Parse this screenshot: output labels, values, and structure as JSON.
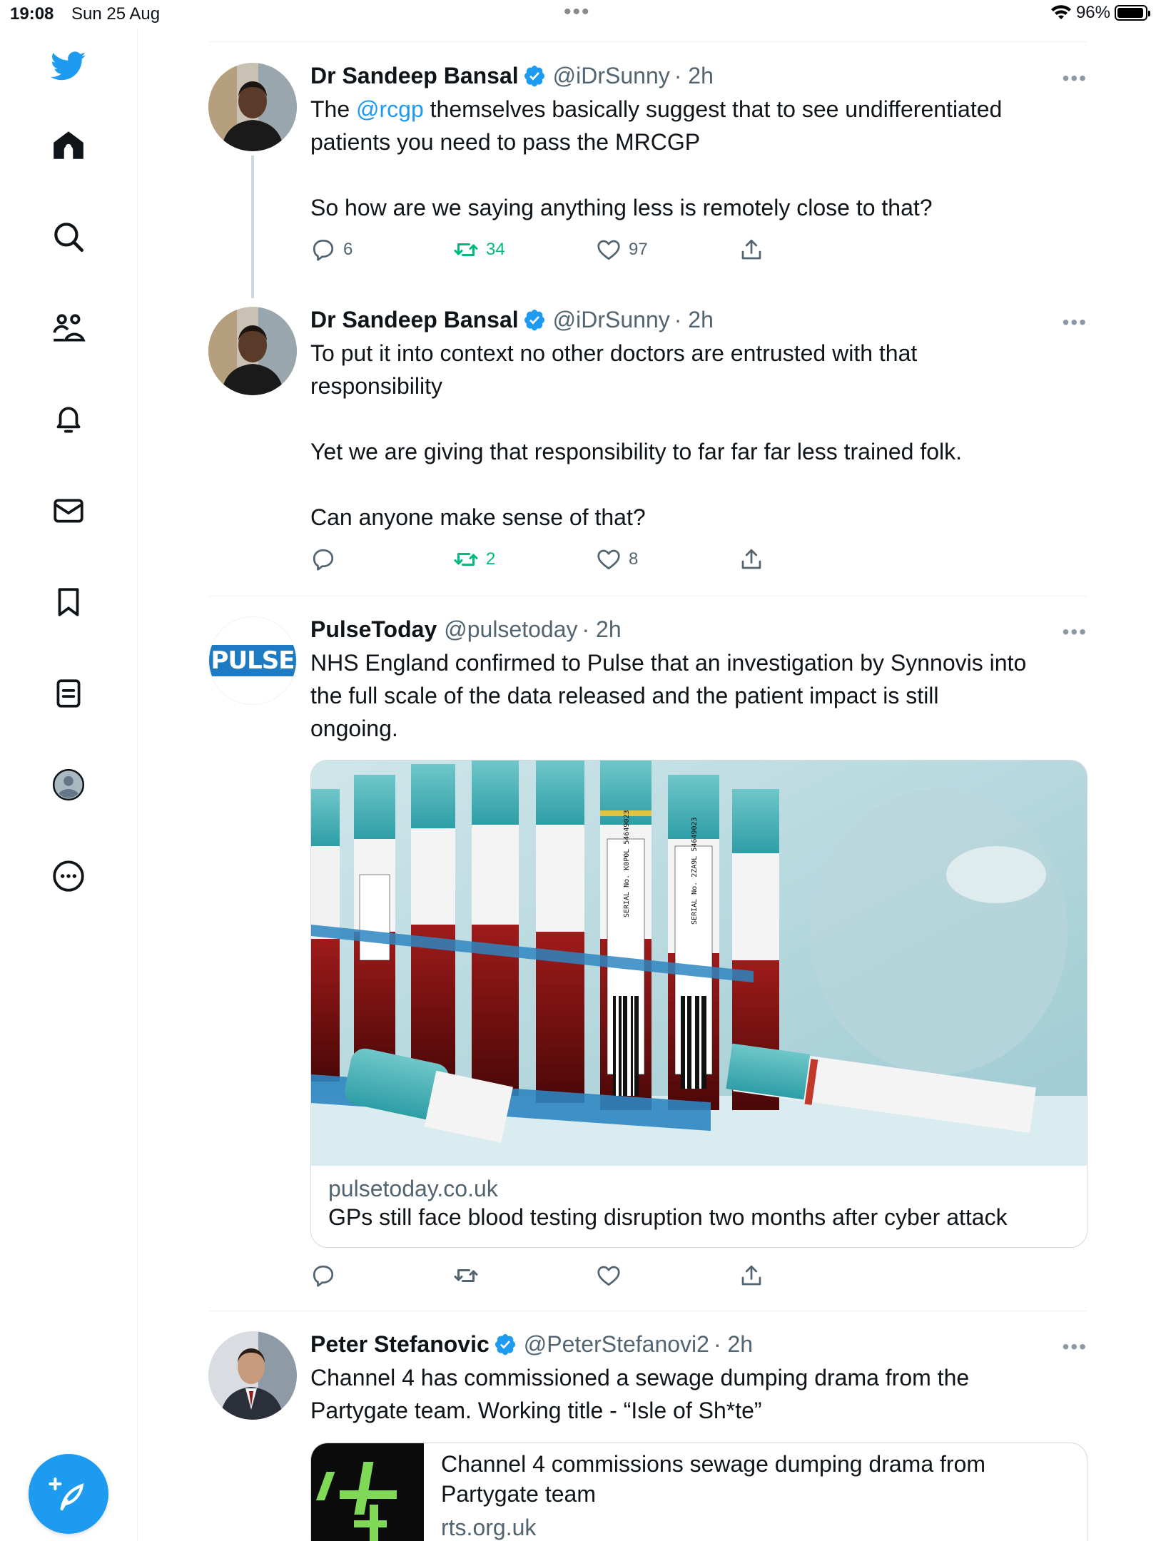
{
  "status_bar": {
    "time": "19:08",
    "date": "Sun 25 Aug",
    "dots": "•••",
    "battery": "96%",
    "battery_level": 0.96
  },
  "sidebar": {
    "items": [
      "twitter-logo",
      "home",
      "explore",
      "communities",
      "notifications",
      "messages",
      "bookmarks",
      "lists",
      "profile",
      "more"
    ]
  },
  "colors": {
    "accent": "#1d9bf0",
    "retweeted": "#00ba7c",
    "muted": "#536471"
  },
  "tweets": [
    {
      "name": "Dr Sandeep Bansal",
      "handle": "@iDrSunny",
      "time": "· 2h",
      "text_pre": "The ",
      "mention": "@rcgp",
      "text_post": " themselves basically suggest that to see undifferentiated\npatients you need to pass the MRCGP\n\nSo how are we saying anything less is remotely close to that?",
      "replies": "6",
      "retweets": "34",
      "likes": "97"
    },
    {
      "name": "Dr Sandeep Bansal",
      "handle": "@iDrSunny",
      "time": "· 2h",
      "text": "To put it into context no other doctors are entrusted with that\nresponsibility\n\nYet we are giving that responsibility to far far far less trained folk.\n\nCan anyone make sense of that?",
      "replies": "",
      "retweets": "2",
      "likes": "8"
    },
    {
      "name": "PulseToday",
      "handle": "@pulsetoday",
      "time": "· 2h",
      "avatar_text": "PULSE",
      "text": "NHS England confirmed to Pulse that an investigation by Synnovis into\nthe full scale of the data released and the patient impact is still\nongoing.",
      "card_domain": "pulsetoday.co.uk",
      "card_title": "GPs still face blood testing disruption two months after cyber attack",
      "image_text_1": "SERIAL No. K0P0L 54649023",
      "image_text_2": "SERIAL No. 2ZA9L 54649023",
      "replies": "",
      "retweets": "",
      "likes": ""
    },
    {
      "name": "Peter Stefanovic",
      "handle": "@PeterStefanovi2",
      "time": "· 2h",
      "text": "Channel 4 has commissioned a sewage dumping drama from the\nPartygate team. Working title - “Isle of Sh*te”",
      "card_title_line1": "Channel 4 commissions sewage dumping drama from",
      "card_title_line2": "Partygate team",
      "card_domain": "rts.org.uk"
    }
  ]
}
